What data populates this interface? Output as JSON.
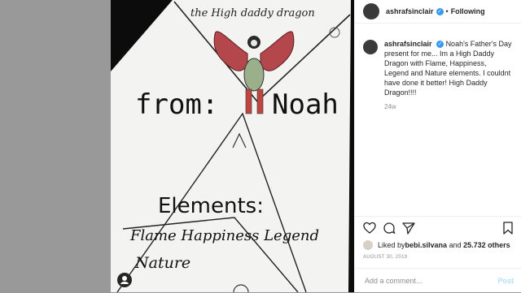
{
  "post": {
    "username": "ashrafsinclair",
    "follow_status": "Following",
    "separator": "•",
    "verified_icon": "verified-badge-icon",
    "caption": "Noah's Father's Day present for me... Im a High Daddy Dragon with Flame, Happiness, Legend and Nature elements. I couldnt have done it better! High Daddy Dragon!!!!",
    "age": "24w",
    "liked_by_prefix": "Liked by ",
    "liked_by_user": "bebi.silvana",
    "liked_by_and": " and ",
    "likes_count": "25.732 others",
    "date": "AUGUST 30, 2019",
    "comment_placeholder": "Add a comment...",
    "post_button": "Post"
  },
  "drawing": {
    "title": "the High daddy dragon",
    "from_word": "from:",
    "from_name": "Noah",
    "elements_heading": "Elements:",
    "elements_line1": "Flame Happiness Legend",
    "elements_line2": "Nature"
  },
  "colors": {
    "accent_blue": "#3897f0",
    "post_disabled": "#b2dffc",
    "dragon_wings": "#b3474b",
    "dragon_body": "#9bb08a"
  }
}
